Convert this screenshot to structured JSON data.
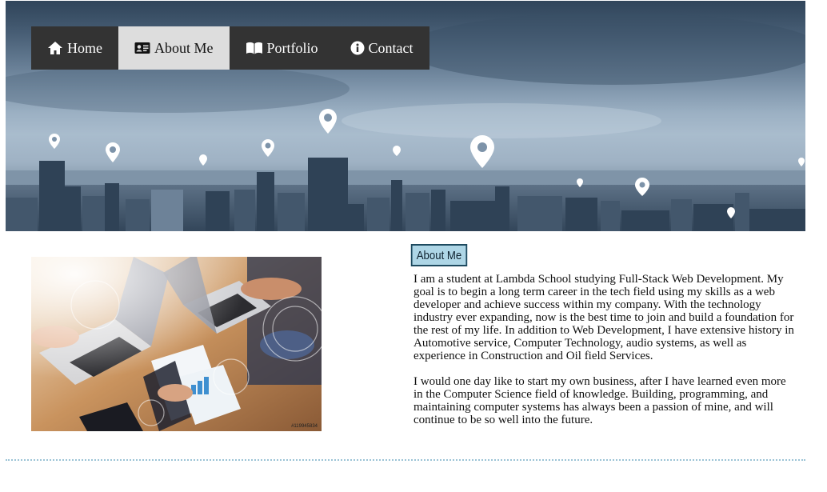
{
  "nav": {
    "items": [
      {
        "label": "Home",
        "icon": "home-icon",
        "active": false
      },
      {
        "label": "About Me",
        "icon": "id-card-icon",
        "active": true
      },
      {
        "label": "Portfolio",
        "icon": "book-icon",
        "active": false
      },
      {
        "label": "Contact",
        "icon": "info-circle-icon",
        "active": false
      }
    ]
  },
  "about": {
    "heading": "About Me",
    "paragraphs": [
      "I am a student at Lambda School studying Full-Stack Web Development. My goal is to begin a long term career in the tech field using my skills as a web developer and achieve success within my company. With the technology industry ever expanding, now is the best time to join and build a foundation for the rest of my life. In addition to Web Development, I have extensive history in Automotive service, Computer Technology, audio systems, as well as experience in Construction and Oil field Services.",
      "I would one day like to start my own business, after I have learned even more in the Computer Science field of knowledge. Building, programming, and maintaining computer systems has always been a passion of mine, and will continue to be so well into the future."
    ]
  },
  "photo": {
    "stock_id": "#119945834"
  },
  "colors": {
    "nav_bg": "#333333",
    "nav_active_bg": "#dddddd",
    "badge_bg": "#aed6e6",
    "badge_border": "#1e4a5f",
    "divider": "#9cc3d6"
  }
}
